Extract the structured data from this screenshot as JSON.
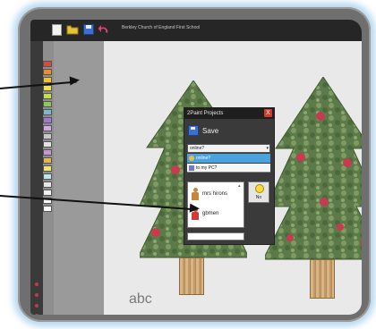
{
  "app": {
    "title": "Berkley Church of England First School",
    "toolbar": {
      "icons": [
        "new-file-icon",
        "open-folder-icon",
        "save-icon",
        "undo-icon"
      ],
      "colors": {
        "open": "#e4c23a",
        "save": "#3b6fd0",
        "undo": "#d9436a"
      }
    }
  },
  "palette": {
    "colors": [
      "#d94a3a",
      "#f08a2a",
      "#f3c12a",
      "#f5e04a",
      "#c2e04a",
      "#8fc85a",
      "#7ab8d6",
      "#9a7ad6",
      "#d6a6e4",
      "#c8c8c8",
      "#e2e2e2",
      "#c896d6",
      "#e6b84a",
      "#f4e46a",
      "#bde6ee",
      "#e8e8e8",
      "#f2f2f2",
      "#ffffff",
      "#ffffff"
    ]
  },
  "canvas": {
    "text": "abc"
  },
  "dialog": {
    "title": "2Paint Projects",
    "close_label": "X",
    "save_label": "Save",
    "location_select": {
      "value": "online?",
      "options": [
        "online?",
        "to my PC?"
      ]
    },
    "users": [
      "mrs hirons",
      "gbmen"
    ],
    "no_label": "No"
  }
}
